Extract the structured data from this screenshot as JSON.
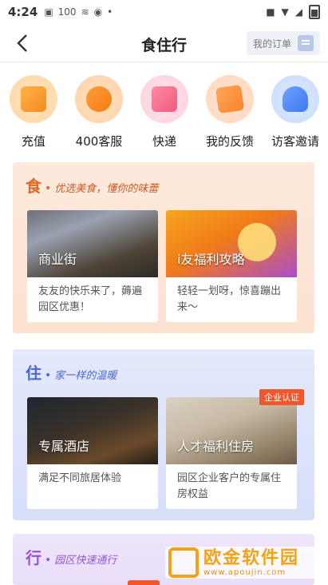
{
  "status_bar": {
    "time": "4:24",
    "icons_left": [
      "sim-icon",
      "100-icon",
      "signal-bars-icon",
      "hotspot-icon",
      "dot-icon"
    ],
    "icons_right": [
      "briefcase-icon",
      "wifi-icon",
      "cell-signal-icon",
      "battery-icon"
    ]
  },
  "header": {
    "title": "食住行",
    "orders_label": "我的订单"
  },
  "quick_actions": [
    {
      "label": "充值",
      "icon": "recharge-icon"
    },
    {
      "label": "400客服",
      "icon": "customer-service-icon"
    },
    {
      "label": "快递",
      "icon": "express-icon"
    },
    {
      "label": "我的反馈",
      "icon": "feedback-icon"
    },
    {
      "label": "访客邀请",
      "icon": "visitor-invite-icon"
    }
  ],
  "sections": {
    "food": {
      "char": "食",
      "subtitle": "优选美食，懂你的味蕾",
      "cards": [
        {
          "title": "商业街",
          "desc": "友友的快乐来了，薅遍园区优惠！"
        },
        {
          "title": "i友福利攻略",
          "desc": "轻轻一划呀，惊喜蹦出来～"
        }
      ]
    },
    "live": {
      "char": "住",
      "subtitle": "家一样的温暖",
      "cards": [
        {
          "title": "专属酒店",
          "desc": "满足不同旅居体验"
        },
        {
          "title": "人才福利住房",
          "desc": "园区企业客户的专属住房权益",
          "badge": "企业认证"
        }
      ]
    },
    "go": {
      "char": "行",
      "subtitle": "园区快速通行"
    }
  },
  "watermark": {
    "name": "欧金软件园",
    "url": "www.apoujin.com"
  },
  "colors": {
    "food_accent": "#e0682d",
    "live_accent": "#4a68d8",
    "go_accent": "#9457cf",
    "badge": "#f2572c"
  }
}
